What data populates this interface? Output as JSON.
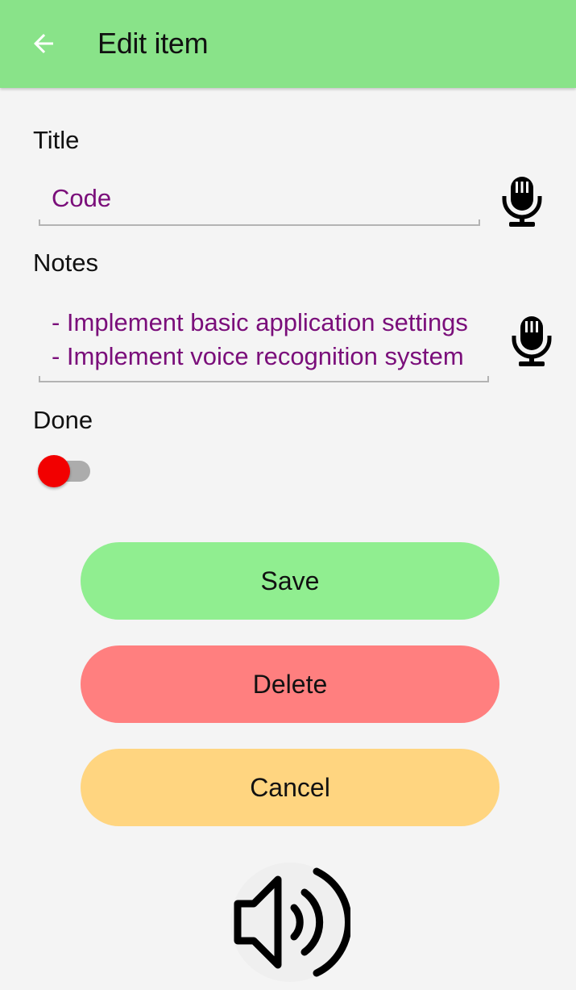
{
  "app_bar": {
    "title": "Edit item",
    "back_icon": "arrow-left-icon",
    "background": "#89e389"
  },
  "form": {
    "title_label": "Title",
    "title_value": "Code",
    "notes_label": "Notes",
    "notes_lines": [
      "- Implement basic application settings",
      "- Implement voice recognition system"
    ],
    "done_label": "Done",
    "done_checked": false,
    "mic_icon": "microphone-icon",
    "value_color": "#7a0e7a"
  },
  "buttons": {
    "save": "Save",
    "delete": "Delete",
    "cancel": "Cancel"
  },
  "colors": {
    "save": "#90ee90",
    "delete": "#ff7f7f",
    "cancel": "#ffd580",
    "toggle_thumb": "#f20000"
  },
  "footer": {
    "speaker_icon": "speaker-icon"
  }
}
